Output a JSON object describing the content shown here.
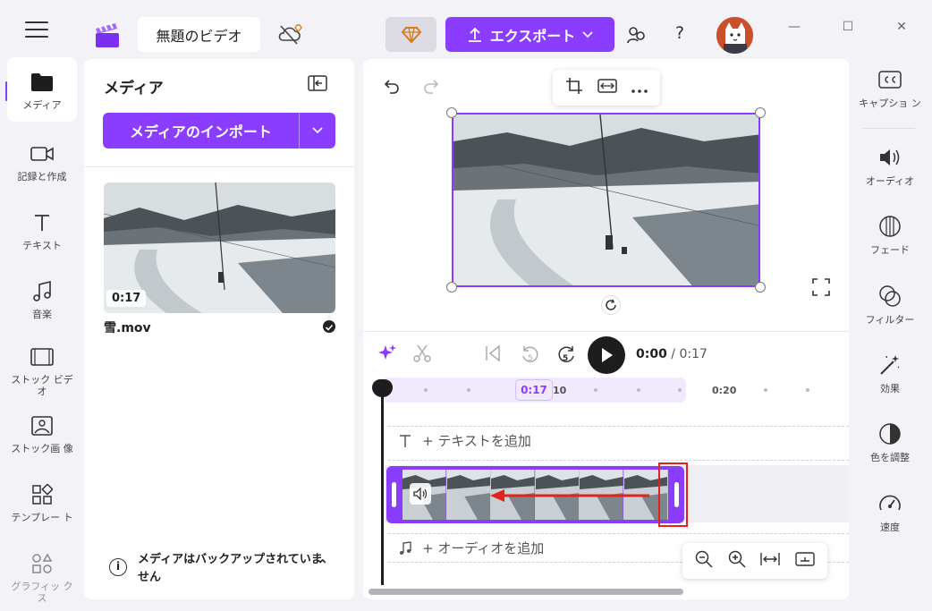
{
  "app": {
    "title": "無題のビデオ",
    "export_label": "エクスポート",
    "help_label": "?",
    "window_controls": [
      "—",
      "☐",
      "✕"
    ]
  },
  "left_rail": {
    "items": [
      {
        "label": "メディア",
        "icon": "folder-icon"
      },
      {
        "label": "記録と作成",
        "icon": "camera-icon"
      },
      {
        "label": "テキスト",
        "icon": "text-icon"
      },
      {
        "label": "音楽",
        "icon": "music-icon"
      },
      {
        "label": "ストック ビデオ",
        "icon": "film-icon"
      },
      {
        "label": "ストック画 像",
        "icon": "image-icon"
      },
      {
        "label": "テンプレー ト",
        "icon": "template-icon"
      },
      {
        "label": "グラフィッ クス",
        "icon": "shapes-icon"
      }
    ]
  },
  "media_panel": {
    "title": "メディア",
    "import_label": "メディアのインポート",
    "asset": {
      "name": "雪.mov",
      "duration": "0:17"
    },
    "backup_message": "メディアはバックアップされていません"
  },
  "playback": {
    "current_time": "0:00",
    "separator": "/",
    "total_time": "0:17",
    "skip_back": "5",
    "skip_forward": "5"
  },
  "timeline": {
    "playhead_label": "0:17",
    "ruler_labels": [
      "10",
      "0:20"
    ],
    "add_text_label": "+ テキストを追加",
    "add_audio_label": "+ オーディオを追加",
    "video_frames": 6
  },
  "right_rail": {
    "items": [
      {
        "label": "キャプショ ン",
        "icon": "captions-icon"
      },
      {
        "label": "オーディオ",
        "icon": "speaker-icon"
      },
      {
        "label": "フェード",
        "icon": "fade-icon"
      },
      {
        "label": "フィルター",
        "icon": "filter-icon"
      },
      {
        "label": "効果",
        "icon": "magic-wand-icon"
      },
      {
        "label": "色を調整",
        "icon": "color-adjust-icon"
      },
      {
        "label": "速度",
        "icon": "speedometer-icon"
      }
    ]
  },
  "colors": {
    "accent": "#8b3dff",
    "highlight": "#e4221c",
    "background": "#f3f2f7"
  }
}
